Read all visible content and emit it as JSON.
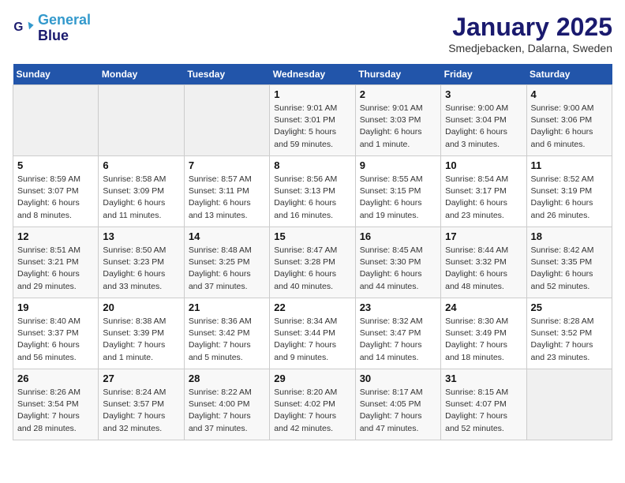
{
  "logo": {
    "line1": "General",
    "line2": "Blue"
  },
  "header": {
    "month_year": "January 2025",
    "location": "Smedjebacken, Dalarna, Sweden"
  },
  "weekdays": [
    "Sunday",
    "Monday",
    "Tuesday",
    "Wednesday",
    "Thursday",
    "Friday",
    "Saturday"
  ],
  "weeks": [
    [
      {
        "day": "",
        "info": ""
      },
      {
        "day": "",
        "info": ""
      },
      {
        "day": "",
        "info": ""
      },
      {
        "day": "1",
        "info": "Sunrise: 9:01 AM\nSunset: 3:01 PM\nDaylight: 5 hours\nand 59 minutes."
      },
      {
        "day": "2",
        "info": "Sunrise: 9:01 AM\nSunset: 3:03 PM\nDaylight: 6 hours\nand 1 minute."
      },
      {
        "day": "3",
        "info": "Sunrise: 9:00 AM\nSunset: 3:04 PM\nDaylight: 6 hours\nand 3 minutes."
      },
      {
        "day": "4",
        "info": "Sunrise: 9:00 AM\nSunset: 3:06 PM\nDaylight: 6 hours\nand 6 minutes."
      }
    ],
    [
      {
        "day": "5",
        "info": "Sunrise: 8:59 AM\nSunset: 3:07 PM\nDaylight: 6 hours\nand 8 minutes."
      },
      {
        "day": "6",
        "info": "Sunrise: 8:58 AM\nSunset: 3:09 PM\nDaylight: 6 hours\nand 11 minutes."
      },
      {
        "day": "7",
        "info": "Sunrise: 8:57 AM\nSunset: 3:11 PM\nDaylight: 6 hours\nand 13 minutes."
      },
      {
        "day": "8",
        "info": "Sunrise: 8:56 AM\nSunset: 3:13 PM\nDaylight: 6 hours\nand 16 minutes."
      },
      {
        "day": "9",
        "info": "Sunrise: 8:55 AM\nSunset: 3:15 PM\nDaylight: 6 hours\nand 19 minutes."
      },
      {
        "day": "10",
        "info": "Sunrise: 8:54 AM\nSunset: 3:17 PM\nDaylight: 6 hours\nand 23 minutes."
      },
      {
        "day": "11",
        "info": "Sunrise: 8:52 AM\nSunset: 3:19 PM\nDaylight: 6 hours\nand 26 minutes."
      }
    ],
    [
      {
        "day": "12",
        "info": "Sunrise: 8:51 AM\nSunset: 3:21 PM\nDaylight: 6 hours\nand 29 minutes."
      },
      {
        "day": "13",
        "info": "Sunrise: 8:50 AM\nSunset: 3:23 PM\nDaylight: 6 hours\nand 33 minutes."
      },
      {
        "day": "14",
        "info": "Sunrise: 8:48 AM\nSunset: 3:25 PM\nDaylight: 6 hours\nand 37 minutes."
      },
      {
        "day": "15",
        "info": "Sunrise: 8:47 AM\nSunset: 3:28 PM\nDaylight: 6 hours\nand 40 minutes."
      },
      {
        "day": "16",
        "info": "Sunrise: 8:45 AM\nSunset: 3:30 PM\nDaylight: 6 hours\nand 44 minutes."
      },
      {
        "day": "17",
        "info": "Sunrise: 8:44 AM\nSunset: 3:32 PM\nDaylight: 6 hours\nand 48 minutes."
      },
      {
        "day": "18",
        "info": "Sunrise: 8:42 AM\nSunset: 3:35 PM\nDaylight: 6 hours\nand 52 minutes."
      }
    ],
    [
      {
        "day": "19",
        "info": "Sunrise: 8:40 AM\nSunset: 3:37 PM\nDaylight: 6 hours\nand 56 minutes."
      },
      {
        "day": "20",
        "info": "Sunrise: 8:38 AM\nSunset: 3:39 PM\nDaylight: 7 hours\nand 1 minute."
      },
      {
        "day": "21",
        "info": "Sunrise: 8:36 AM\nSunset: 3:42 PM\nDaylight: 7 hours\nand 5 minutes."
      },
      {
        "day": "22",
        "info": "Sunrise: 8:34 AM\nSunset: 3:44 PM\nDaylight: 7 hours\nand 9 minutes."
      },
      {
        "day": "23",
        "info": "Sunrise: 8:32 AM\nSunset: 3:47 PM\nDaylight: 7 hours\nand 14 minutes."
      },
      {
        "day": "24",
        "info": "Sunrise: 8:30 AM\nSunset: 3:49 PM\nDaylight: 7 hours\nand 18 minutes."
      },
      {
        "day": "25",
        "info": "Sunrise: 8:28 AM\nSunset: 3:52 PM\nDaylight: 7 hours\nand 23 minutes."
      }
    ],
    [
      {
        "day": "26",
        "info": "Sunrise: 8:26 AM\nSunset: 3:54 PM\nDaylight: 7 hours\nand 28 minutes."
      },
      {
        "day": "27",
        "info": "Sunrise: 8:24 AM\nSunset: 3:57 PM\nDaylight: 7 hours\nand 32 minutes."
      },
      {
        "day": "28",
        "info": "Sunrise: 8:22 AM\nSunset: 4:00 PM\nDaylight: 7 hours\nand 37 minutes."
      },
      {
        "day": "29",
        "info": "Sunrise: 8:20 AM\nSunset: 4:02 PM\nDaylight: 7 hours\nand 42 minutes."
      },
      {
        "day": "30",
        "info": "Sunrise: 8:17 AM\nSunset: 4:05 PM\nDaylight: 7 hours\nand 47 minutes."
      },
      {
        "day": "31",
        "info": "Sunrise: 8:15 AM\nSunset: 4:07 PM\nDaylight: 7 hours\nand 52 minutes."
      },
      {
        "day": "",
        "info": ""
      }
    ]
  ]
}
